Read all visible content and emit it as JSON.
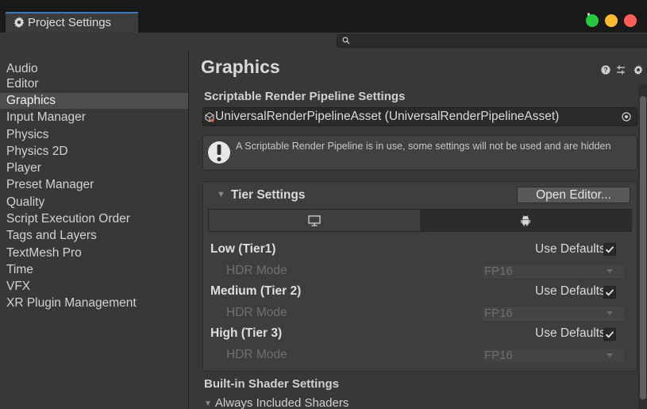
{
  "window": {
    "tab_title": "Project Settings",
    "traffic_lights": [
      "#27c93f",
      "#ffbd2e",
      "#ff5f56"
    ]
  },
  "search": {
    "value": "",
    "placeholder": ""
  },
  "sidebar": {
    "items": [
      {
        "label": "Audio"
      },
      {
        "label": "Editor"
      },
      {
        "label": "Graphics"
      },
      {
        "label": "Input Manager"
      },
      {
        "label": "Physics"
      },
      {
        "label": "Physics 2D"
      },
      {
        "label": "Player"
      },
      {
        "label": "Preset Manager"
      },
      {
        "label": "Quality"
      },
      {
        "label": "Script Execution Order"
      },
      {
        "label": "Tags and Layers"
      },
      {
        "label": "TextMesh Pro"
      },
      {
        "label": "Time"
      },
      {
        "label": "VFX"
      },
      {
        "label": "XR Plugin Management"
      }
    ],
    "selected": "Graphics"
  },
  "main": {
    "title": "Graphics",
    "srp": {
      "heading": "Scriptable Render Pipeline Settings",
      "asset": "UniversalRenderPipelineAsset (UniversalRenderPipelineAsset)"
    },
    "help_message": "A Scriptable Render Pipeline is in use, some settings will not be used and are hidden",
    "tier_settings": {
      "label": "Tier Settings",
      "open_editor": "Open Editor...",
      "platform_tabs": [
        "desktop-icon",
        "android-icon"
      ],
      "tiers": [
        {
          "name": "Low (Tier1)",
          "use_defaults_label": "Use Defaults",
          "use_defaults": true,
          "hdr_label": "HDR Mode",
          "hdr_value": "FP16"
        },
        {
          "name": "Medium (Tier 2)",
          "use_defaults_label": "Use Defaults",
          "use_defaults": true,
          "hdr_label": "HDR Mode",
          "hdr_value": "FP16"
        },
        {
          "name": "High (Tier 3)",
          "use_defaults_label": "Use Defaults",
          "use_defaults": true,
          "hdr_label": "HDR Mode",
          "hdr_value": "FP16"
        }
      ]
    },
    "builtin": {
      "heading": "Built-in Shader Settings",
      "always_included": "Always Included Shaders"
    }
  }
}
